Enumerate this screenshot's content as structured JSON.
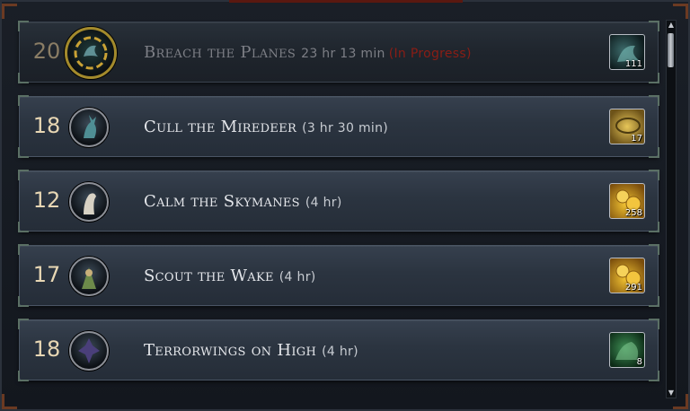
{
  "missions": [
    {
      "level": "20",
      "title": "Breach the Planes",
      "duration": "23 hr 13 min",
      "status": "(In Progress)",
      "active": true,
      "portrait_icon": "gold-dragon-portrait-icon",
      "reward": {
        "icon": "teal-creature-reward-icon",
        "style": "teal",
        "count": "111"
      }
    },
    {
      "level": "18",
      "title": "Cull the Miredeer",
      "duration": "(3 hr 30 min)",
      "status": "",
      "active": false,
      "portrait_icon": "stag-portrait-icon",
      "reward": {
        "icon": "gold-coin-reward-icon",
        "style": "gold",
        "count": "17"
      }
    },
    {
      "level": "12",
      "title": "Calm the Skymanes",
      "duration": "(4 hr)",
      "status": "",
      "active": false,
      "portrait_icon": "horse-portrait-icon",
      "reward": {
        "icon": "gold-coins-reward-icon",
        "style": "coins",
        "count": "258"
      }
    },
    {
      "level": "17",
      "title": "Scout the Wake",
      "duration": "(4 hr)",
      "status": "",
      "active": false,
      "portrait_icon": "scout-portrait-icon",
      "reward": {
        "icon": "gold-coins-reward-icon",
        "style": "coins",
        "count": "291"
      }
    },
    {
      "level": "18",
      "title": "Terrorwings on High",
      "duration": "(4 hr)",
      "status": "",
      "active": false,
      "portrait_icon": "bat-creature-portrait-icon",
      "reward": {
        "icon": "green-creature-reward-icon",
        "style": "green",
        "count": "8"
      }
    }
  ],
  "scrollbar": {
    "up_icon": "scroll-up-arrow-icon",
    "down_icon": "scroll-down-arrow-icon"
  },
  "colors": {
    "status": "#8a1d15",
    "level": "#e8d7b4",
    "title": "#e4e6ea"
  }
}
